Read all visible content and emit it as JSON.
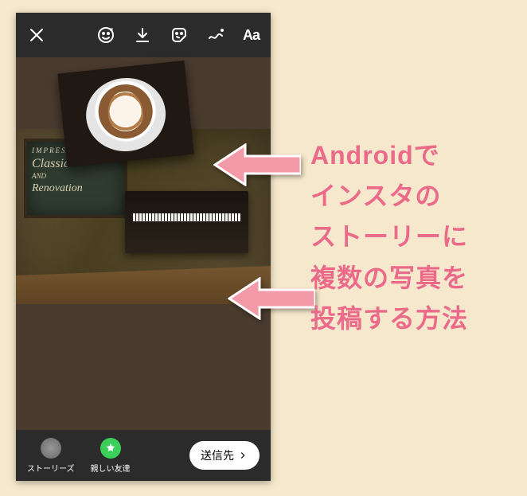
{
  "toolbar": {
    "aa_label": "Aa"
  },
  "bottom": {
    "stories_label": "ストーリーズ",
    "close_friends_label": "親しい友達",
    "send_label": "送信先"
  },
  "headline": {
    "line1": "Androidで",
    "line2": "インスタの",
    "line3": "ストーリーに",
    "line4": "複数の写真を",
    "line5": "投稿する方法"
  },
  "sign": {
    "l1": "IMPRESSION",
    "l2": "Classic",
    "l3": "AND",
    "l4": "Renovation"
  }
}
